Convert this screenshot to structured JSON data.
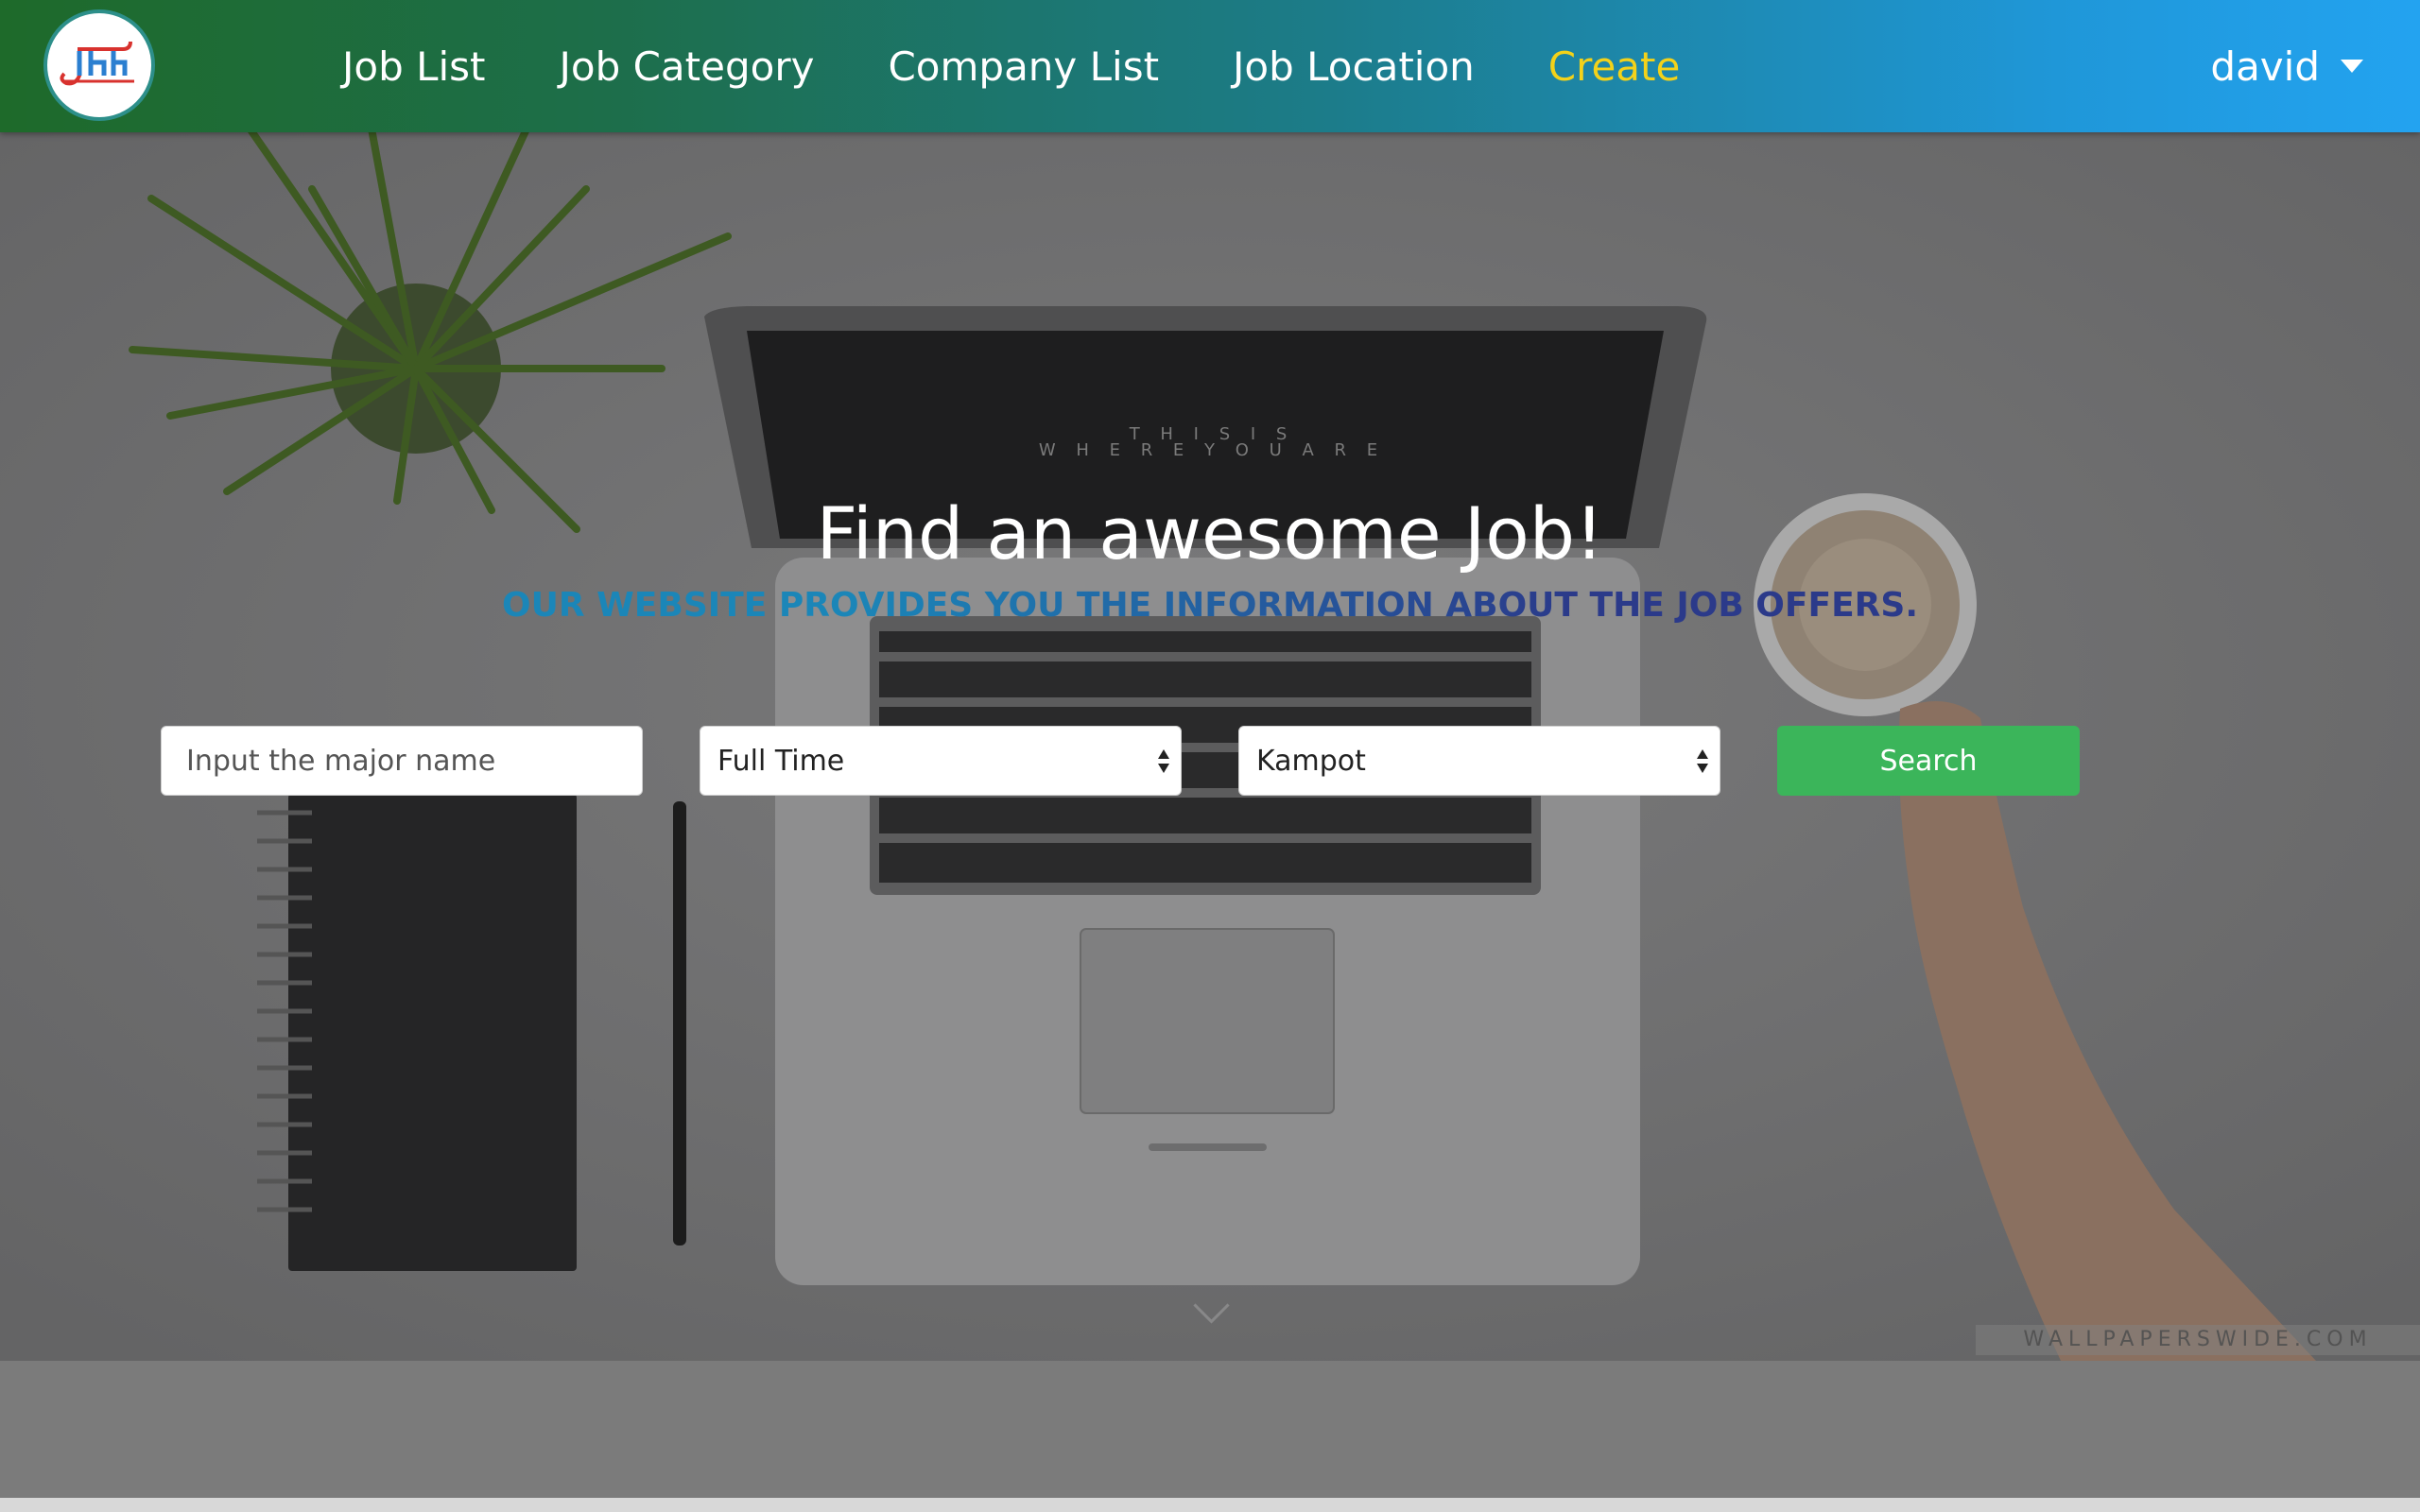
{
  "navbar": {
    "links": [
      {
        "label": "Job List"
      },
      {
        "label": "Job Category"
      },
      {
        "label": "Company List"
      },
      {
        "label": "Job Location"
      },
      {
        "label": "Create"
      }
    ],
    "user": {
      "name": "david"
    },
    "colors": {
      "gradient_start": "#1e6a2a",
      "gradient_end": "#23a3f0",
      "create_link": "#f3d21a"
    }
  },
  "hero": {
    "title": "Find an awesome Job!",
    "subtitle": "OUR WEBSITE PROVIDES YOU THE INFORMATION ABOUT THE JOB OFFERS.",
    "laptop_screen_line1": "T H I S   I S",
    "laptop_screen_line2": "W H E R E   Y O U   A R E",
    "watermark": "WALLPAPERSWIDE.COM"
  },
  "search": {
    "major_placeholder": "Input the major name",
    "major_value": "",
    "job_type": {
      "selected": "Full Time"
    },
    "location": {
      "selected": "Kampot"
    },
    "button_label": "Search",
    "button_color": "#3bb55a"
  }
}
